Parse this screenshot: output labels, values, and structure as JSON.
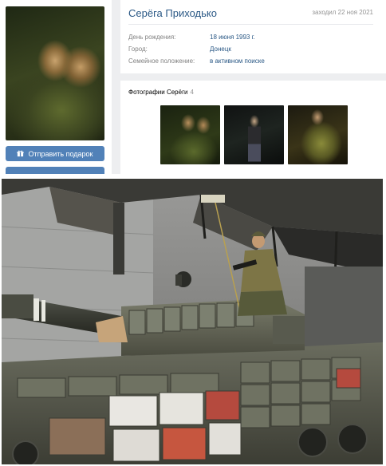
{
  "profile": {
    "name": "Серёга Приходько",
    "last_seen": "заходил 22 ноя 2021",
    "info": [
      {
        "label": "День рождения:",
        "value": "18 июня 1993 г."
      },
      {
        "label": "Город:",
        "value": "Донецк"
      },
      {
        "label": "Семейное положение:",
        "value": "в активном поиске"
      }
    ]
  },
  "actions": {
    "gift_label": "Отправить подарок"
  },
  "photos": {
    "title": "Фотографии Серёги",
    "count": "4"
  },
  "colors": {
    "accent": "#5181b8",
    "link": "#2a5885",
    "muted": "#828282",
    "page_bg": "#edeef0"
  },
  "icons": {
    "gift": "gift-icon"
  }
}
